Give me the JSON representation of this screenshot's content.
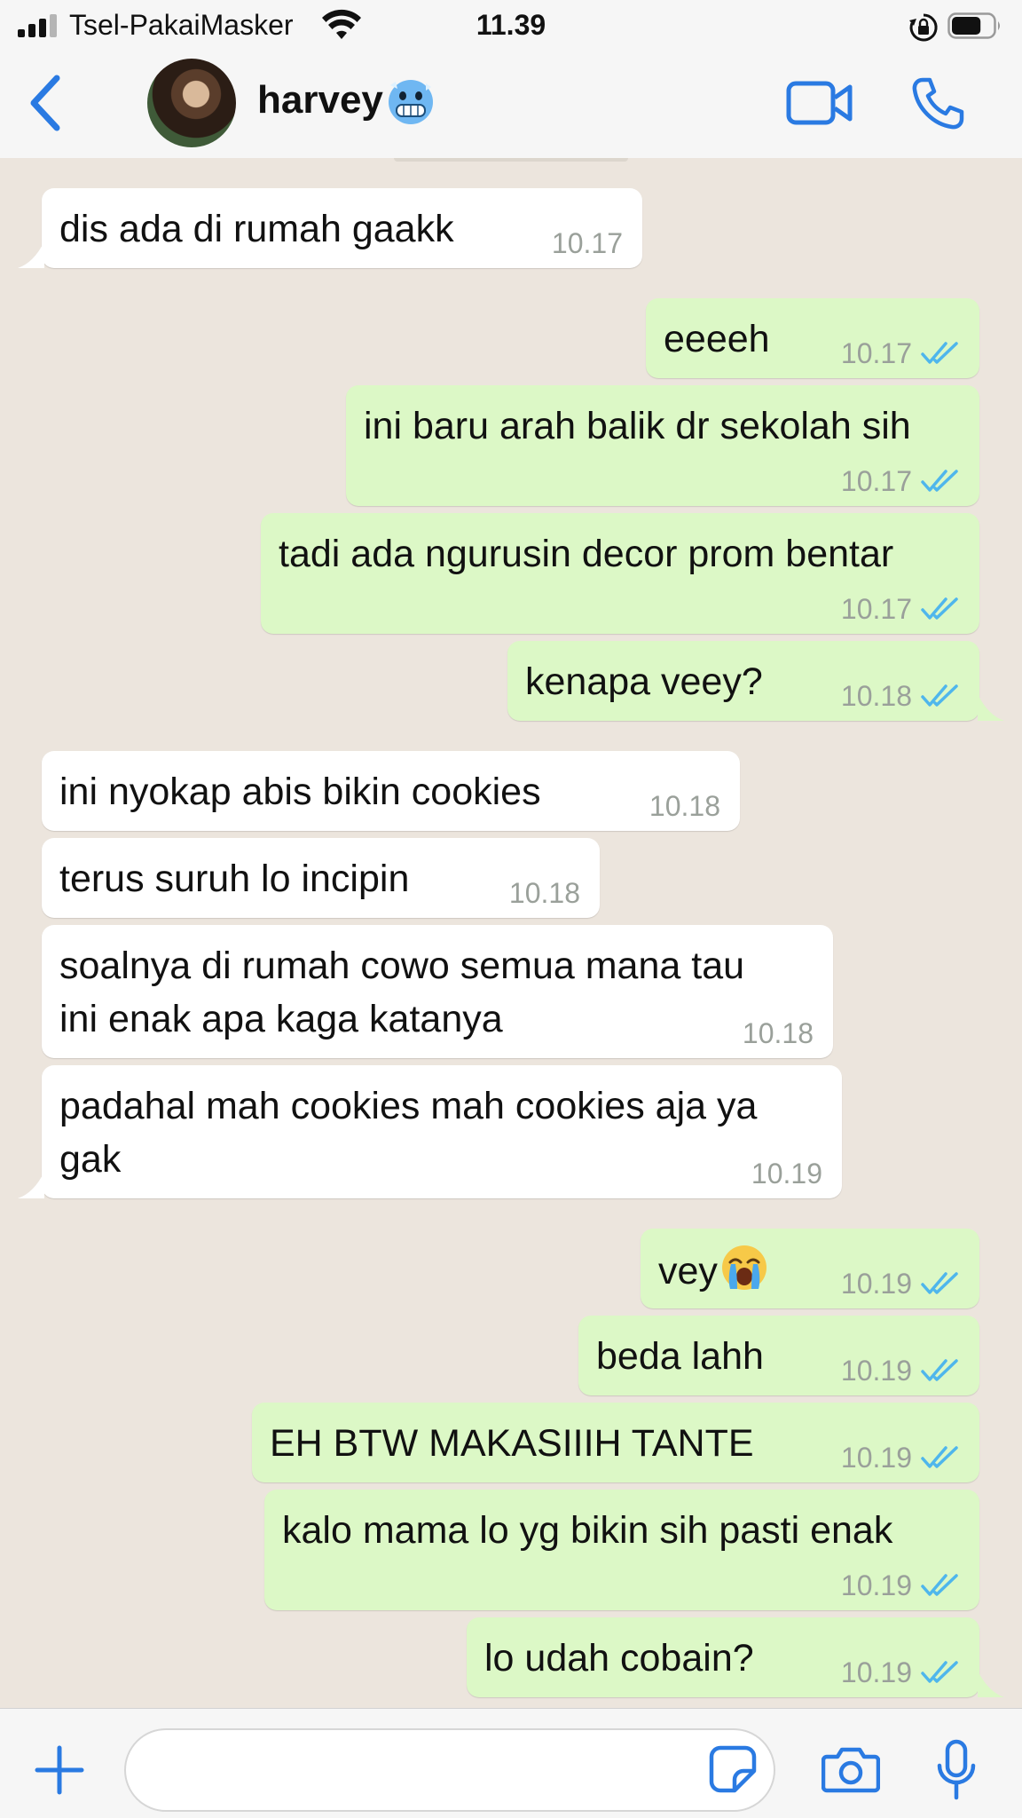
{
  "status_bar": {
    "carrier": "Tsel-PakaiMasker",
    "time": "11.39",
    "signal_bars": 3,
    "battery_level": 0.7
  },
  "header": {
    "contact_name": "harvey",
    "name_emoji": "cold-face",
    "back_icon": "chevron-left-icon",
    "video_icon": "video-camera-icon",
    "call_icon": "phone-icon",
    "accent_color": "#2a7ae2"
  },
  "messages": [
    {
      "dir": "in",
      "text": "dis ada di rumah gaakk",
      "time": "10.17"
    },
    {
      "dir": "out",
      "text": "eeeeh",
      "time": "10.17",
      "read": true
    },
    {
      "dir": "out",
      "text": "ini baru arah balik dr sekolah sih",
      "time": "10.17",
      "read": true
    },
    {
      "dir": "out",
      "text": "tadi ada ngurusin decor prom bentar",
      "time": "10.17",
      "read": true
    },
    {
      "dir": "out",
      "text": "kenapa veey?",
      "time": "10.18",
      "read": true
    },
    {
      "dir": "in",
      "text": "ini nyokap abis bikin cookies",
      "time": "10.18"
    },
    {
      "dir": "in",
      "text": "terus suruh lo incipin",
      "time": "10.18"
    },
    {
      "dir": "in",
      "line1": "soalnya di rumah cowo semua mana tau",
      "line2": "ini enak apa kaga katanya",
      "time": "10.18"
    },
    {
      "dir": "in",
      "line1": "padahal mah cookies mah cookies aja ya",
      "line2": "gak",
      "time": "10.19"
    },
    {
      "dir": "out",
      "text": "vey",
      "emoji": "loudly-crying-face",
      "time": "10.19",
      "read": true
    },
    {
      "dir": "out",
      "text": "beda lahh",
      "time": "10.19",
      "read": true
    },
    {
      "dir": "out",
      "text": "EH BTW MAKASIIIH TANTE",
      "time": "10.19",
      "read": true
    },
    {
      "dir": "out",
      "text": "kalo mama lo yg bikin sih pasti enak",
      "time": "10.19",
      "read": true
    },
    {
      "dir": "out",
      "text": "lo udah cobain?",
      "time": "10.19",
      "read": true
    }
  ],
  "input_bar": {
    "message_value": "",
    "plus_icon": "plus-icon",
    "sticker_icon": "sticker-icon",
    "camera_icon": "camera-icon",
    "mic_icon": "microphone-icon"
  },
  "colors": {
    "chat_background": "#ece5dd",
    "incoming_bubble": "#ffffff",
    "outgoing_bubble": "#dcf8c6",
    "read_ticks": "#4fb6ec"
  }
}
